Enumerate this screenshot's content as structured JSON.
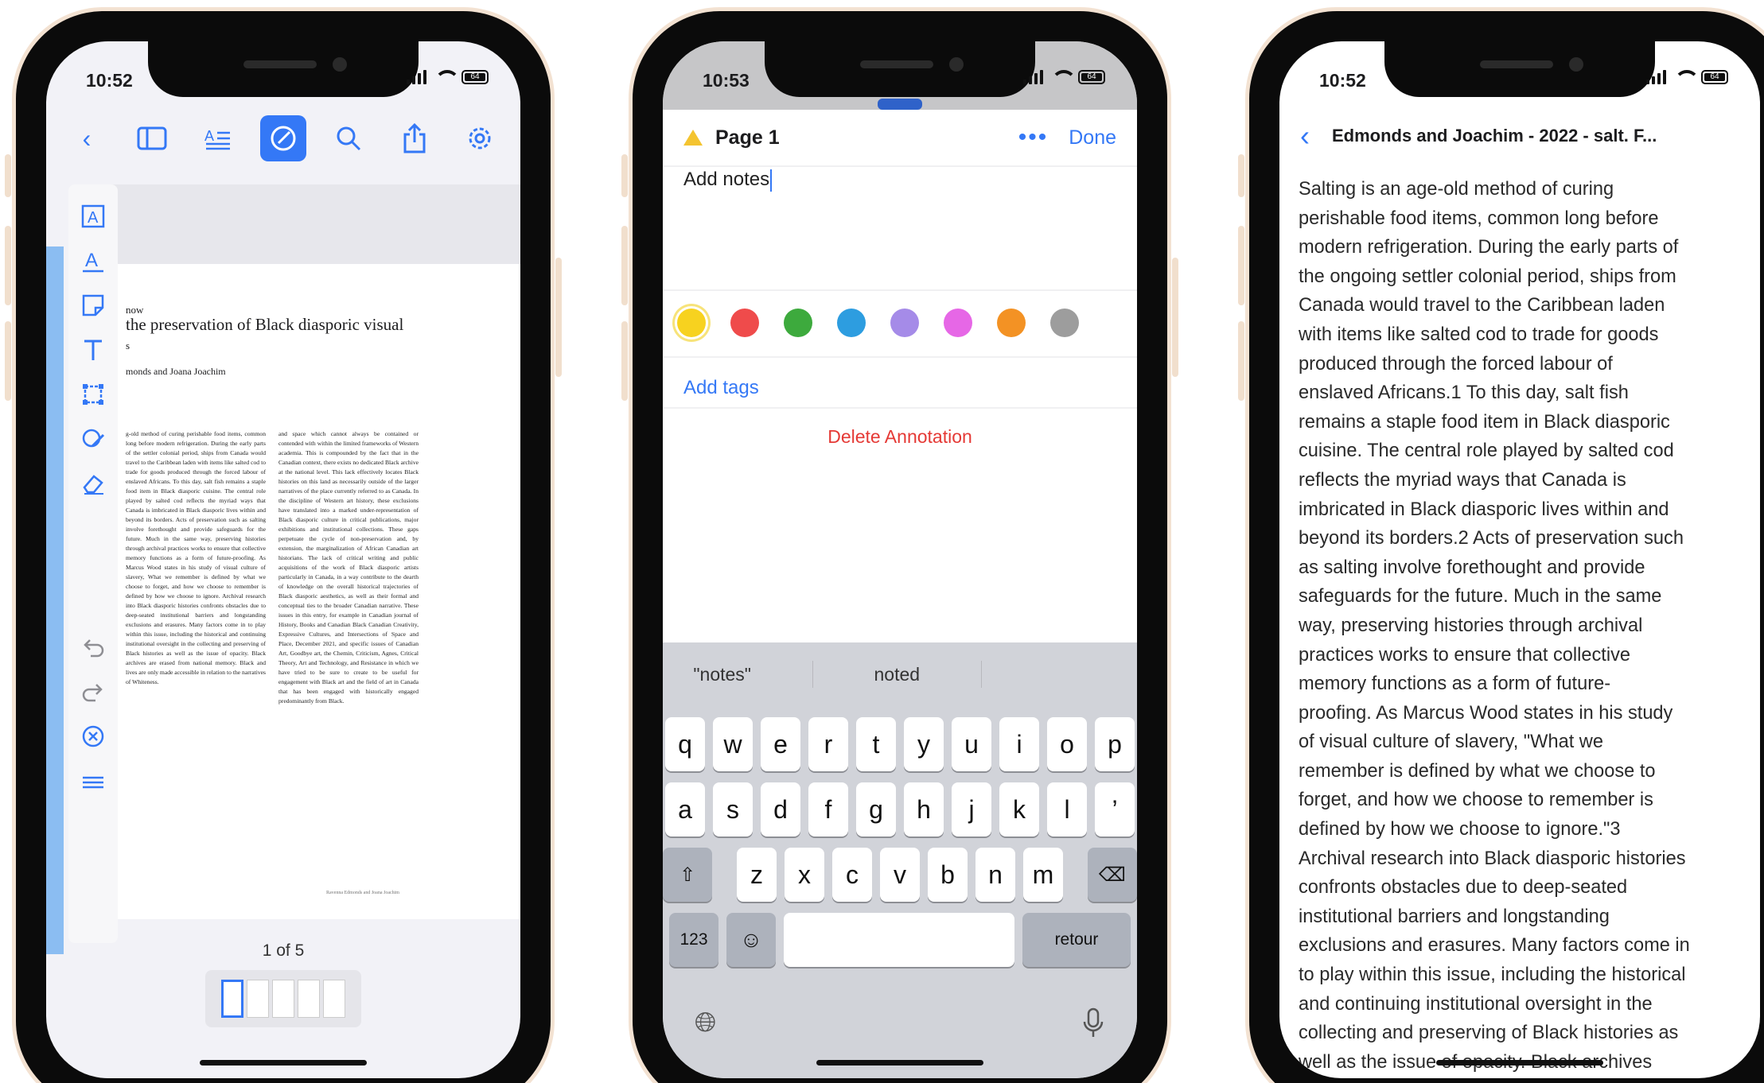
{
  "status": {
    "time_1": "10:52",
    "time_2": "10:53",
    "time_3": "10:52",
    "battery": "64"
  },
  "phone1": {
    "toolbar_icons": [
      "chevron-left-icon",
      "sidebar-icon",
      "text-outline-icon",
      "annotate-icon",
      "search-icon",
      "share-icon",
      "gear-icon"
    ],
    "tools": [
      "text-box-icon",
      "text-markup-icon",
      "note-icon",
      "text-icon",
      "crop-icon",
      "signature-icon",
      "eraser-icon"
    ],
    "doc_heading_line1": "now",
    "doc_title": "the preservation of Black diasporic visual",
    "doc_heading_line2": "s",
    "doc_authors": "monds and Joana Joachim",
    "col_left": "g-old method of curing perishable food items, common long before modern refrigeration. During the early parts of the settler colonial period, ships from Canada would travel to the Caribbean laden with items like salted cod to trade for goods produced through the forced labour of enslaved Africans. To this day, salt fish remains a staple food item in Black diasporic cuisine. The central role played by salted cod reflects the myriad ways that Canada is imbricated in Black diasporic lives within and beyond its borders. Acts of preservation such as salting involve forethought and provide safeguards for the future. Much in the same way, preserving histories through archival practices works to ensure that collective memory functions as a form of future-proofing. As Marcus Wood states in his study of visual culture of slavery, What we remember is defined by what we choose to forget, and how we choose to remember is defined by how we choose to ignore. Archival research into Black diasporic histories confronts obstacles due to deep-seated institutional barriers and longstanding exclusions and erasures. Many factors come in to play within this issue, including the historical and continuing institutional oversight in the collecting and preserving of Black histories as well as the issue of opacity. Black archives are erased from national memory. Black and lives are only made accessible in relation to the narratives of Whiteness.",
    "col_right": "and space which cannot always be contained or contended with within the limited frameworks of Western academia. This is compounded by the fact that in the Canadian context, there exists no dedicated Black archive at the national level. This lack effectively locates Black histories on this land as necessarily outside of the larger narratives of the place currently referred to as Canada. In the discipline of Western art history, these exclusions have translated into a marked under-representation of Black diasporic culture in critical publications, major exhibitions and institutional collections. These gaps perpetuate the cycle of non-preservation and, by extension, the marginalization of African Canadian art historians. The lack of critical writing and public acquisitions of the work of Black diasporic artists particularly in Canada, in a way contribute to the dearth of knowledge on the overall historical trajectories of Black diasporic aesthetics, as well as their formal and conceptual ties to the broader Canadian narrative. These issues in this entry, for example in Canadian journal of History, Books and Canadian Black Canadian Creativity, Expressive Cultures, and Intersections of Space and Place, December 2021, and specific issues of Canadian Art, Goodbye art, the Chemin, Criticism, Agnes, Critical Theory, Art and Technology, and Resistance in which we have tried to be sure to create to be useful for engagement with Black art and the field of art in Canada that has been engaged with historically engaged predominantly from Black.",
    "doc_footer": "Ravenna Edmonds and Joana Joachim",
    "nav_icons": [
      "undo-icon",
      "redo-icon",
      "close-circle-icon",
      "menu-icon"
    ],
    "page_count": "1 of 5"
  },
  "phone2": {
    "page_label": "Page 1",
    "more_label": "•••",
    "done_label": "Done",
    "notes_text": "Add notes",
    "colors": [
      "#f7d21f",
      "#ef4b4b",
      "#3daa3d",
      "#2d9de0",
      "#a58be8",
      "#e667e6",
      "#f39224",
      "#9d9d9d"
    ],
    "add_tags": "Add tags",
    "delete_label": "Delete Annotation",
    "suggestions": [
      "\"notes\"",
      "noted",
      ""
    ],
    "row1": [
      "q",
      "w",
      "e",
      "r",
      "t",
      "y",
      "u",
      "i",
      "o",
      "p"
    ],
    "row2": [
      "a",
      "s",
      "d",
      "f",
      "g",
      "h",
      "j",
      "k",
      "l",
      "’"
    ],
    "row3": [
      "z",
      "x",
      "c",
      "v",
      "b",
      "n",
      "m"
    ],
    "key_num": "123",
    "key_return": "retour"
  },
  "phone3": {
    "nav_title": "Edmonds and Joachim - 2022 - salt. F...",
    "lines": [
      "Salting is an age-old method of curing",
      "perishable food items, common long before",
      "modern refrigeration. During the early parts of",
      "the ongoing settler colonial period, ships from",
      "Canada would travel to the Caribbean laden",
      "with items like salted cod to trade for goods",
      "produced through the forced labour of",
      "enslaved Africans.1 To this day, salt fish",
      "remains a staple food item in Black diasporic",
      "cuisine. The central role played by salted cod",
      "reflects the myriad ways that Canada is",
      "imbricated in Black diasporic lives within and",
      "beyond its borders.2 Acts of preservation such",
      "as salting involve forethought and provide",
      "safeguards for the future. Much in the same",
      "way, preserving histories through archival",
      "practices works to ensure that collective",
      "memory functions as a form of future-",
      "proofing. As Marcus Wood states in his study",
      "of visual culture of slavery, \"What we",
      "remember is defined by what we choose to",
      "forget, and how we choose to remember is",
      "defined by how we choose to ignore.\"3",
      "Archival research into Black diasporic histories",
      "confronts obstacles due to deep-seated",
      "institutional barriers and longstanding",
      "exclusions and erasures. Many factors come in",
      "to play within this issue, including the historical",
      "and continuing institutional oversight in the",
      "collecting and preserving of Black histories as",
      "well as the issue of opacity. Black archives"
    ]
  }
}
